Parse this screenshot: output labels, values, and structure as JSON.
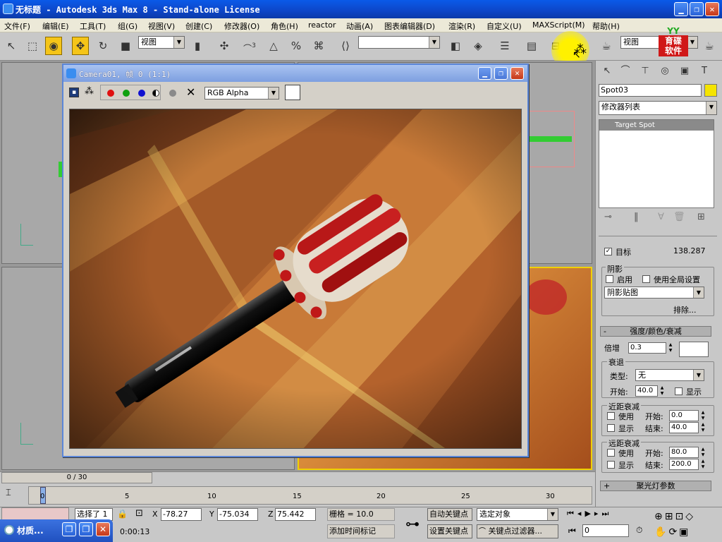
{
  "window": {
    "title": "无标题   - Autodesk 3ds Max 8   - Stand-alone License",
    "min_glyph": "▁",
    "max_glyph": "❐",
    "close_glyph": "✕"
  },
  "menu": [
    "文件(F)",
    "编辑(E)",
    "工具(T)",
    "组(G)",
    "视图(V)",
    "创建(C)",
    "修改器(O)",
    "角色(H)",
    "reactor",
    "动画(A)",
    "图表编辑器(D)",
    "渲染(R)",
    "自定义(U)",
    "MAXScript(M)",
    "帮助(H)"
  ],
  "toolbar": {
    "view_dropdown": "视图",
    "view_dropdown2": "视图",
    "angle_snap_label": "3",
    "percent_label": "%",
    "selection_set": ""
  },
  "logo": {
    "mark": "YY",
    "line1": "育碟",
    "line2": "软件"
  },
  "render_window": {
    "title": "Camera01, 帧 0 (1:1)",
    "channel": "RGB Alpha"
  },
  "panel": {
    "object_name": "Spot03",
    "modifier_list": "修改器列表",
    "stack_item": "Target Spot",
    "target_label": "目标",
    "target_value": "138.287",
    "shadows_group": "阴影",
    "shadows_on": "启用",
    "global_settings": "使用全局设置",
    "shadow_type": "阴影贴图",
    "exclude": "排除...",
    "intensity_rollout": "强度/颜色/衰减",
    "rollout_minus": "-",
    "rollout_plus": "+",
    "multiplier_label": "倍增",
    "multiplier_value": "0.3",
    "decay_group": "衰退",
    "type_label": "类型:",
    "type_value": "无",
    "start_label": "开始:",
    "start_value": "40.0",
    "show_label": "显示",
    "near_atten_group": "近距衰减",
    "use_label": "使用",
    "start_label2": "开始:",
    "end_label": "结束:",
    "near_start": "0.0",
    "near_end": "40.0",
    "far_atten_group": "远距衰减",
    "far_start": "80.0",
    "far_end": "200.0",
    "spotlight_rollout": "聚光灯参数",
    "checked": "✓"
  },
  "timeline": {
    "frame_counter": "0 / 30",
    "ticks": [
      "0",
      "5",
      "10",
      "15",
      "20",
      "25",
      "30"
    ]
  },
  "status": {
    "selected": "选择了 1",
    "x_label": "X",
    "x_value": "-78.27",
    "y_label": "Y",
    "y_value": "-75.034",
    "z_label": "Z",
    "z_value": "75.442",
    "grid": "栅格 = 10.0",
    "auto_key": "自动关键点",
    "selected_obj": "选定对象",
    "set_key": "设置关键点",
    "key_filters": "关键点过滤器...",
    "time_tag": "添加时间标记",
    "time": "0:00:13",
    "current_frame": "0"
  },
  "taskbar": {
    "item": "材质..."
  }
}
